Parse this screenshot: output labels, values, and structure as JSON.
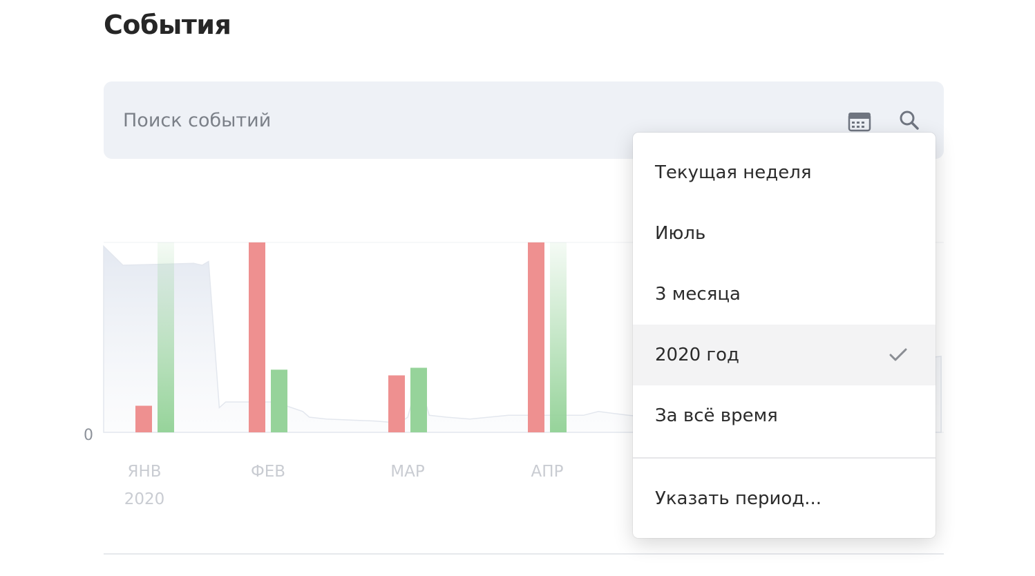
{
  "page": {
    "title": "События"
  },
  "search": {
    "placeholder": "Поиск событий",
    "calendar_icon": "calendar-icon",
    "search_icon": "search-icon"
  },
  "period_menu": {
    "items": [
      {
        "label": "Текущая неделя",
        "selected": false
      },
      {
        "label": "Июль",
        "selected": false
      },
      {
        "label": "3 месяца",
        "selected": false
      },
      {
        "label": "2020 год",
        "selected": true
      },
      {
        "label": "За всё время",
        "selected": false
      }
    ],
    "custom_label": "Указать период..."
  },
  "colors": {
    "negative": "#ee9090",
    "positive": "#96d39a",
    "area": "#e9edf4",
    "accent_bg": "#eef1f6"
  },
  "chart_data": {
    "type": "bar",
    "y_zero_label": "0",
    "categories": [
      "ЯНВ",
      "ФЕВ",
      "МАР",
      "АПР"
    ],
    "first_category_sublabel": "2020",
    "ylim": [
      0,
      100
    ],
    "series": [
      {
        "color": "#ee9090",
        "values": [
          14,
          100,
          30,
          100
        ]
      },
      {
        "color": "#96d39a",
        "values": [
          100,
          33,
          34,
          100
        ]
      }
    ],
    "gradient_series_points": [
      0,
      3
    ],
    "background_area": [
      [
        0,
        98
      ],
      [
        9,
        88
      ],
      [
        42,
        89
      ],
      [
        46,
        88
      ],
      [
        49,
        90
      ],
      [
        54,
        13
      ],
      [
        57,
        16
      ],
      [
        62,
        16
      ],
      [
        80,
        16
      ],
      [
        93,
        11
      ],
      [
        96,
        8
      ],
      [
        104,
        7
      ],
      [
        126,
        6
      ],
      [
        138,
        5
      ],
      [
        142,
        8
      ],
      [
        147,
        29
      ],
      [
        152,
        9
      ],
      [
        160,
        8
      ],
      [
        171,
        7
      ],
      [
        189,
        9
      ],
      [
        192,
        9
      ],
      [
        199,
        9
      ],
      [
        208,
        9
      ],
      [
        224,
        9
      ],
      [
        231,
        11
      ],
      [
        245,
        9
      ],
      [
        254,
        8
      ],
      [
        270,
        8
      ],
      [
        274,
        24
      ],
      [
        284,
        24
      ],
      [
        292,
        22
      ],
      [
        297,
        22
      ],
      [
        301,
        10
      ],
      [
        313,
        10
      ],
      [
        320,
        10
      ],
      [
        331,
        10
      ],
      [
        335,
        100
      ],
      [
        341,
        23
      ],
      [
        343,
        38
      ],
      [
        350,
        37
      ],
      [
        363,
        37
      ],
      [
        391,
        40
      ]
    ]
  }
}
